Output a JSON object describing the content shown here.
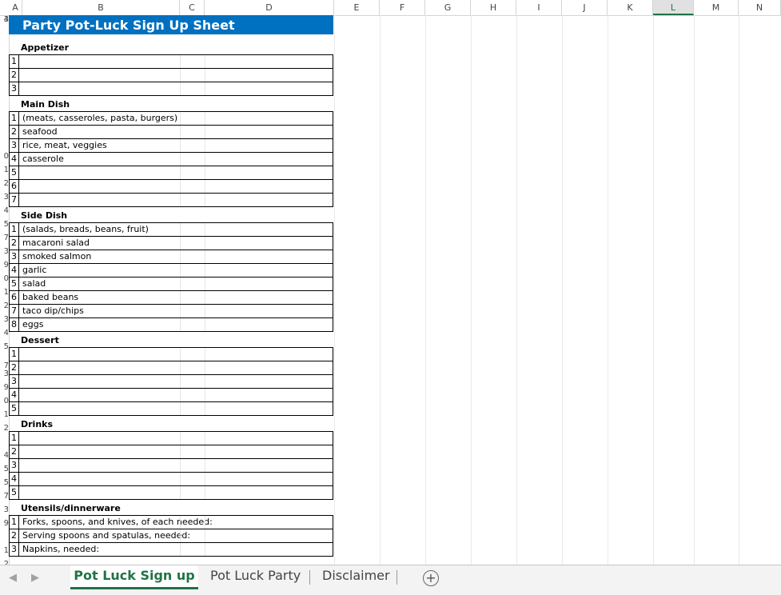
{
  "columns": [
    "A",
    "B",
    "C",
    "D",
    "E",
    "F",
    "G",
    "H",
    "I",
    "J",
    "K",
    "L",
    "M",
    "N"
  ],
  "selected_column": "L",
  "row_numbers": [
    "",
    "",
    "",
    "",
    "",
    "",
    "",
    "",
    "",
    "",
    "",
    "",
    "",
    "",
    "",
    "",
    "",
    "",
    "",
    "",
    "",
    "",
    "",
    "",
    "",
    "",
    "",
    "",
    "",
    "",
    "",
    "",
    "",
    "",
    "",
    "",
    "",
    "",
    "",
    "",
    "",
    ""
  ],
  "title": "Party Pot-Luck Sign Up Sheet",
  "sections": [
    {
      "label": "Appetizer",
      "rows": [
        {
          "n": "1",
          "t": ""
        },
        {
          "n": "2",
          "t": ""
        },
        {
          "n": "3",
          "t": ""
        }
      ]
    },
    {
      "label": "Main Dish",
      "rows": [
        {
          "n": "1",
          "t": "(meats, casseroles, pasta, burgers)"
        },
        {
          "n": "2",
          "t": "seafood"
        },
        {
          "n": "3",
          "t": "rice, meat, veggies"
        },
        {
          "n": "4",
          "t": "casserole"
        },
        {
          "n": "5",
          "t": ""
        },
        {
          "n": "6",
          "t": ""
        },
        {
          "n": "7",
          "t": ""
        }
      ]
    },
    {
      "label": "Side Dish",
      "rows": [
        {
          "n": "1",
          "t": "(salads, breads, beans, fruit)"
        },
        {
          "n": "2",
          "t": "macaroni salad"
        },
        {
          "n": "3",
          "t": "smoked salmon"
        },
        {
          "n": "4",
          "t": "garlic"
        },
        {
          "n": "5",
          "t": "salad"
        },
        {
          "n": "6",
          "t": "baked beans"
        },
        {
          "n": "7",
          "t": "taco dip/chips"
        },
        {
          "n": "8",
          "t": "eggs"
        }
      ]
    },
    {
      "label": "Dessert",
      "rows": [
        {
          "n": "1",
          "t": ""
        },
        {
          "n": "2",
          "t": ""
        },
        {
          "n": "3",
          "t": ""
        },
        {
          "n": "4",
          "t": ""
        },
        {
          "n": "5",
          "t": ""
        }
      ]
    },
    {
      "label": "Drinks",
      "rows": [
        {
          "n": "1",
          "t": ""
        },
        {
          "n": "2",
          "t": ""
        },
        {
          "n": "3",
          "t": ""
        },
        {
          "n": "4",
          "t": ""
        },
        {
          "n": "5",
          "t": ""
        }
      ]
    },
    {
      "label": "Utensils/dinnerware",
      "rows": [
        {
          "n": "1",
          "t": "Forks, spoons, and knives,      of each needed:"
        },
        {
          "n": "2",
          "t": "Serving spoons and spatulas,      needed:"
        },
        {
          "n": "3",
          "t": "Napkins,     needed:"
        }
      ]
    }
  ],
  "row_header_digits": [
    "",
    "",
    "",
    "",
    "",
    "",
    "",
    "",
    "",
    "",
    "0",
    "1",
    "2",
    "3",
    "4",
    "5",
    "",
    "7",
    "3",
    "9",
    "0",
    "1",
    "2",
    "3",
    "4",
    "5",
    "",
    "7",
    "3",
    "9",
    "0",
    "1",
    "2",
    "",
    "4",
    "5",
    "5",
    "7",
    "3",
    "9",
    "",
    "1",
    "2",
    "3",
    "4"
  ],
  "sheet_tabs": [
    {
      "label": "Pot Luck Sign up",
      "active": true
    },
    {
      "label": "Pot Luck Party",
      "active": false
    },
    {
      "label": "Disclaimer",
      "active": false
    }
  ],
  "icons": {
    "prev": "triangle-left-icon",
    "next": "triangle-right-icon",
    "add": "plus-circle-icon"
  }
}
